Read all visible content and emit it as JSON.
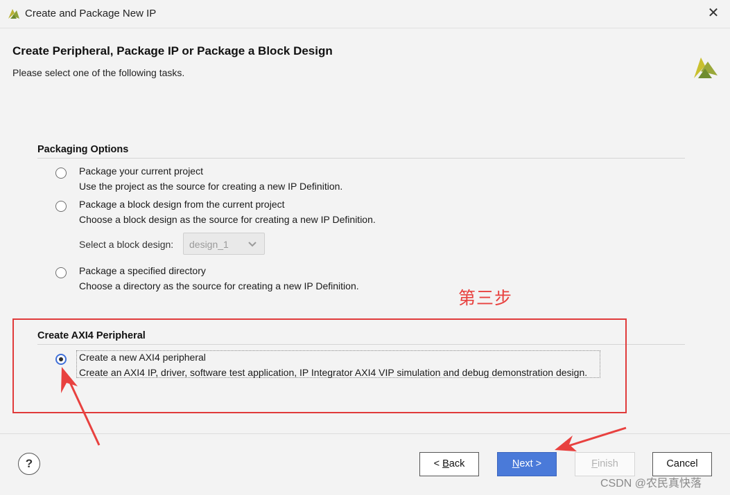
{
  "window": {
    "title": "Create and Package New IP",
    "close_symbol": "✕"
  },
  "header": {
    "title": "Create Peripheral, Package IP or Package a Block Design",
    "subtitle": "Please select one of the following tasks."
  },
  "packaging": {
    "section_title": "Packaging Options",
    "options": [
      {
        "label": "Package your current project",
        "description": "Use the project as the source for creating a new IP Definition.",
        "selected": false
      },
      {
        "label": "Package a block design from the current project",
        "description": "Choose a block design as the source for creating a new IP Definition.",
        "selected": false
      },
      {
        "label": "Package a specified directory",
        "description": "Choose a directory as the source for creating a new IP Definition.",
        "selected": false
      }
    ],
    "block_design_select": {
      "label": "Select a block design:",
      "value": "design_1",
      "enabled": false
    }
  },
  "axi": {
    "section_title": "Create AXI4 Peripheral",
    "option": {
      "label": "Create a new AXI4 peripheral",
      "description": "Create an AXI4 IP, driver, software test application, IP Integrator AXI4 VIP simulation and debug demonstration design.",
      "selected": true
    }
  },
  "annotation": {
    "text": "第三步",
    "color": "#e8413f"
  },
  "footer": {
    "help_label": "?",
    "back_mnemonic": "B",
    "back_rest": "ack",
    "back_prefix": "< ",
    "next_mnemonic": "N",
    "next_rest": "ext >",
    "finish_mnemonic": "F",
    "finish_rest": "inish",
    "cancel_label": "Cancel"
  },
  "watermark": "CSDN @农民真快落",
  "colors": {
    "primary_button": "#4a7ad9",
    "annotation_red": "#e03a3a",
    "logo_yellow": "#c9c02e",
    "logo_green": "#9aa83a"
  }
}
